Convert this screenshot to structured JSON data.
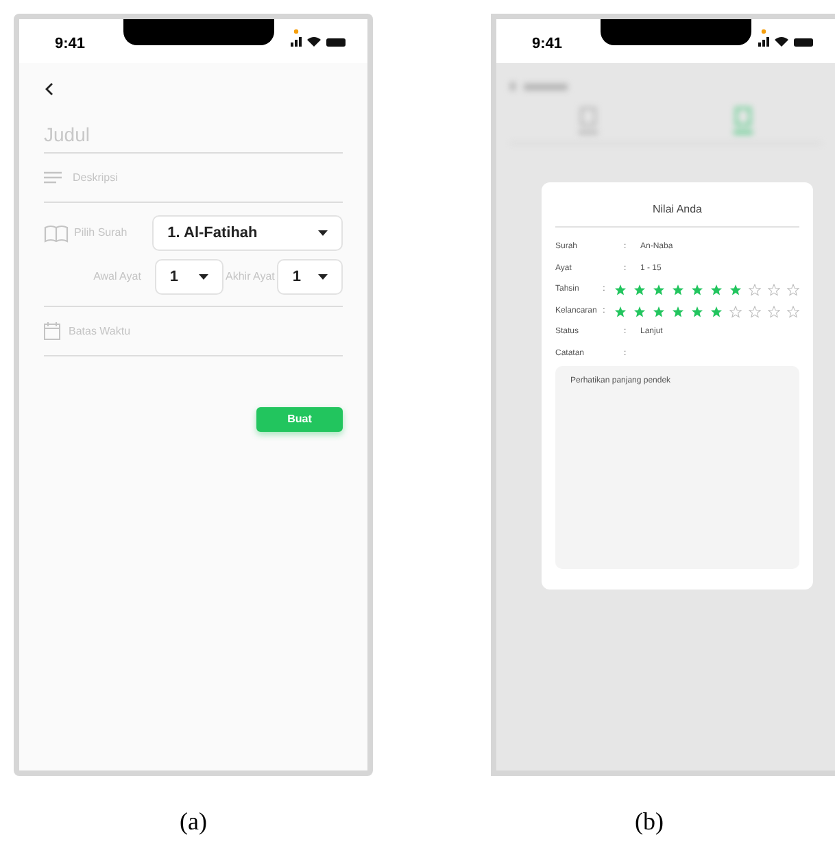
{
  "panel_a": {
    "status_time": "9:41",
    "title_placeholder": "Judul",
    "description_placeholder": "Deskripsi",
    "surah_label": "Pilih Surah",
    "surah_value": "1. Al-Fatihah",
    "start_label": "Awal Ayat",
    "start_value": "1",
    "end_label": "Akhir Ayat",
    "end_value": "1",
    "deadline_placeholder": "Batas Waktu",
    "submit": "Buat",
    "caption": "(a)"
  },
  "panel_b": {
    "status_time": "9:41",
    "dialog": {
      "title": "Nilai Anda",
      "rows": [
        {
          "kind": "text",
          "label": "Surah",
          "separator": ":",
          "value": "An-Naba"
        },
        {
          "kind": "text",
          "label": "Ayat",
          "separator": ":",
          "value": "1 - 15"
        },
        {
          "kind": "stars",
          "label": "Tahsin",
          "separator": ":",
          "stars": 7
        },
        {
          "kind": "stars",
          "label": "Kelancaran",
          "separator": ":",
          "stars": 6
        },
        {
          "kind": "text",
          "label": "Status",
          "separator": ":",
          "value": "Lanjut"
        },
        {
          "kind": "text",
          "label": "Catatan",
          "separator": ":"
        }
      ],
      "note": "Perhatikan panjang pendek"
    },
    "caption": "(b)"
  }
}
